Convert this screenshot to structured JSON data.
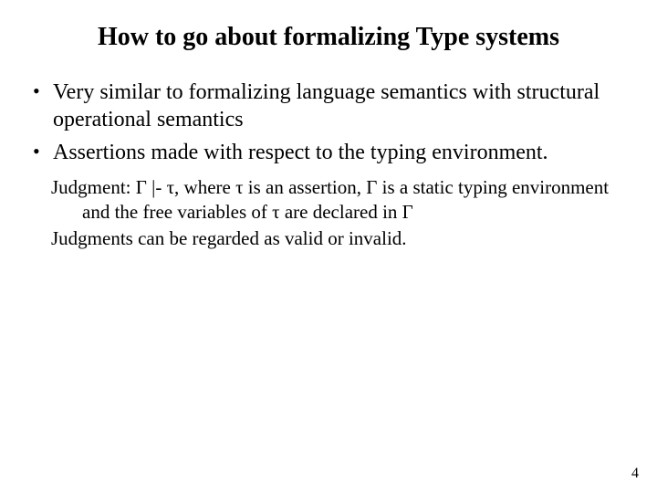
{
  "title": "How to go about formalizing Type systems",
  "bullets": [
    "Very similar to formalizing language semantics with structural operational semantics",
    "Assertions made with respect to the typing environment."
  ],
  "sub": {
    "judgment": "Judgment: Γ |- τ,  where τ is an assertion, Γ is a static typing environment and the free variables of τ are declared in Γ",
    "validity": "Judgments can be regarded as valid or invalid."
  },
  "page_number": "4"
}
